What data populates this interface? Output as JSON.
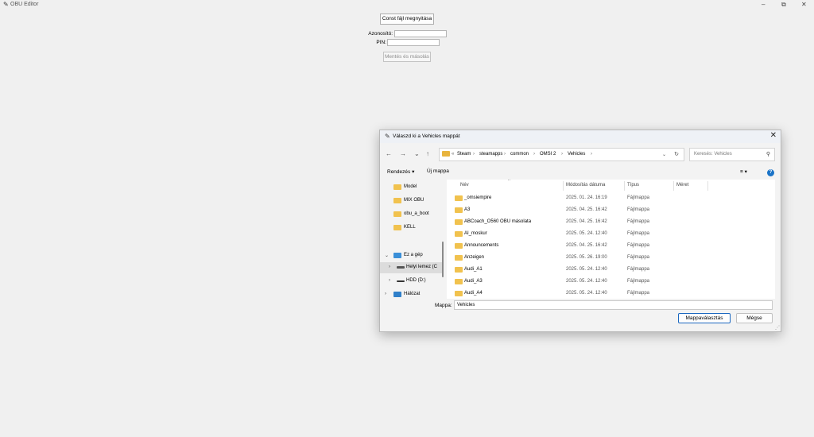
{
  "app": {
    "title": "OBU Editor",
    "minimize": "–",
    "restore": "⧉",
    "close": "✕"
  },
  "main": {
    "open_button": "Const fájl megnyitása",
    "id_label": "Azonosító:",
    "pin_label": "PIN:",
    "save_button": "Mentés és másolás"
  },
  "dialog": {
    "title": "Válaszd ki a Vehicles mappát",
    "close": "✕",
    "nav": {
      "back": "←",
      "forward": "→",
      "recent": "⌄",
      "up": "↑"
    },
    "address": {
      "more": "«",
      "crumbs": [
        "Steam",
        "steamapps",
        "common",
        "OMSI 2",
        "Vehicles"
      ],
      "separator": "›"
    },
    "search_placeholder": "Keresés: Vehicles",
    "toolbar": {
      "organize": "Rendezés ▾",
      "new_folder": "Új mappa",
      "view": "≡ ▾",
      "help": "?"
    },
    "nav_pane": [
      {
        "label": "Model"
      },
      {
        "label": "MIX OBU"
      },
      {
        "label": "obu_a_boot"
      },
      {
        "label": "KELL"
      },
      {
        "label": "Ez a gép"
      },
      {
        "label": "Helyi lemez (C"
      },
      {
        "label": "HDD (D:)"
      },
      {
        "label": "Hálózat"
      }
    ],
    "columns": [
      "Név",
      "Módosítás dátuma",
      "Típus",
      "Méret"
    ],
    "files": [
      {
        "name": "_omsiempire",
        "date": "2025. 01. 24. 16:19",
        "type": "Fájlmappa"
      },
      {
        "name": "A3",
        "date": "2025. 04. 25. 16:42",
        "type": "Fájlmappa"
      },
      {
        "name": "ABCoach_O560 OBU másolata",
        "date": "2025. 04. 25. 16:42",
        "type": "Fájlmappa"
      },
      {
        "name": "AI_moskur",
        "date": "2025. 05. 24. 12:40",
        "type": "Fájlmappa"
      },
      {
        "name": "Announcements",
        "date": "2025. 04. 25. 16:42",
        "type": "Fájlmappa"
      },
      {
        "name": "Anzeigen",
        "date": "2025. 05. 26. 19:00",
        "type": "Fájlmappa"
      },
      {
        "name": "Audi_A1",
        "date": "2025. 05. 24. 12:40",
        "type": "Fájlmappa"
      },
      {
        "name": "Audi_A3",
        "date": "2025. 05. 24. 12:40",
        "type": "Fájlmappa"
      },
      {
        "name": "Audi_A4",
        "date": "2025. 05. 24. 12:40",
        "type": "Fájlmappa"
      }
    ],
    "folder_label": "Mappa:",
    "folder_value": "Vehicles",
    "select_button": "Mappaválasztás",
    "cancel_button": "Mégse"
  }
}
